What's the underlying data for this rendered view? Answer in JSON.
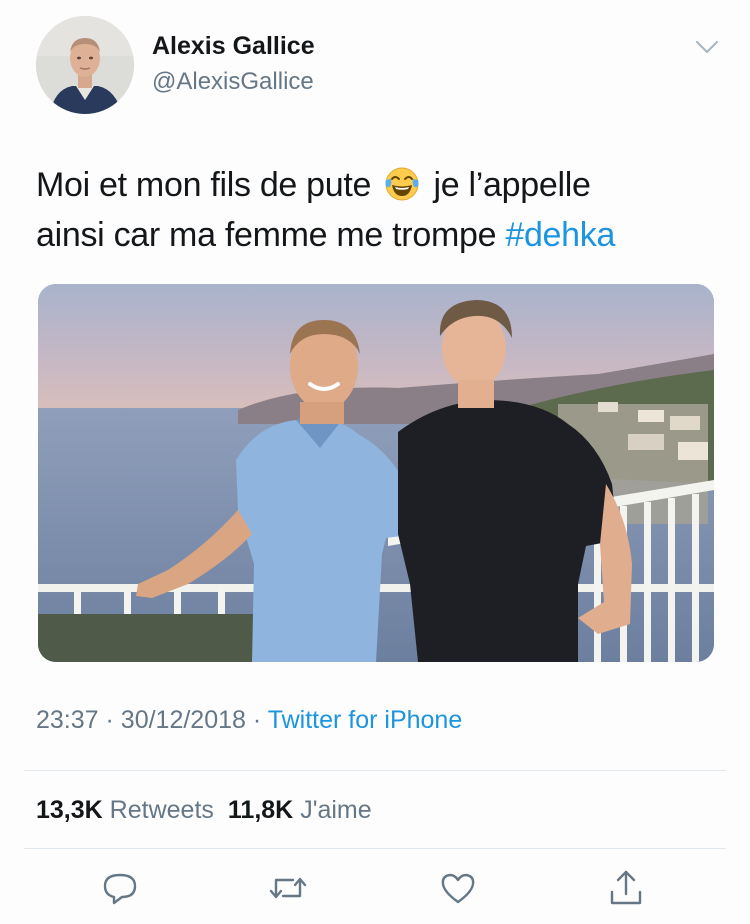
{
  "author": {
    "name": "Alexis Gallice",
    "handle": "@AlexisGallice"
  },
  "tweet": {
    "line1_before_emoji": "Moi et mon fils de pute",
    "emoji": "face-with-tears-of-joy",
    "line1_after_emoji": "je l’appelle",
    "line2_text": "ainsi car ma femme me trompe",
    "hashtag": "#dehka"
  },
  "meta": {
    "time": "23:37",
    "separator": "·",
    "date": "30/12/2018",
    "source": "Twitter for iPhone"
  },
  "stats": {
    "retweets_count": "13,3K",
    "retweets_label": "Retweets",
    "likes_count": "11,8K",
    "likes_label": "J'aime"
  },
  "actions": [
    "reply-icon",
    "retweet-icon",
    "like-icon",
    "share-icon"
  ],
  "colors": {
    "text": "#14171a",
    "secondary": "#657786",
    "link": "#1b95e0",
    "divider": "#e1e8ed"
  }
}
